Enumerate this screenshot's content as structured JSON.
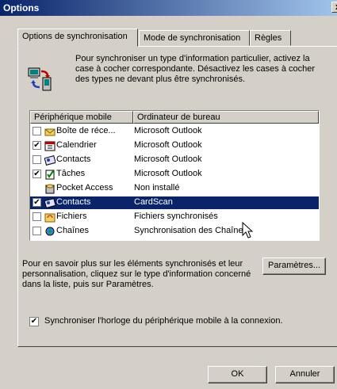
{
  "window": {
    "title": "Options",
    "close_glyph": "x"
  },
  "tabs": [
    {
      "label": "Options de synchronisation",
      "active": true
    },
    {
      "label": "Mode de synchronisation",
      "active": false
    },
    {
      "label": "Règles",
      "active": false
    }
  ],
  "intro": {
    "icon": "sync-icon",
    "text": "Pour synchroniser un type d'information particulier, activez la case à cocher correspondante. Désactivez les cases à cocher des types ne devant plus être synchronisés."
  },
  "list": {
    "headers": {
      "device": "Périphérique mobile",
      "desktop": "Ordinateur de bureau"
    },
    "rows": [
      {
        "device": "Boîte de réce...",
        "desktop": "Microsoft Outlook",
        "checked": false,
        "has_checkbox": true,
        "icon": "inbox-icon",
        "selected": false
      },
      {
        "device": "Calendrier",
        "desktop": "Microsoft Outlook",
        "checked": true,
        "has_checkbox": true,
        "icon": "calendar-icon",
        "selected": false
      },
      {
        "device": "Contacts",
        "desktop": "Microsoft Outlook",
        "checked": false,
        "has_checkbox": true,
        "icon": "contacts-icon",
        "selected": false
      },
      {
        "device": "Tâches",
        "desktop": "Microsoft Outlook",
        "checked": true,
        "has_checkbox": true,
        "icon": "tasks-icon",
        "selected": false
      },
      {
        "device": "Pocket Access",
        "desktop": "Non installé",
        "checked": false,
        "has_checkbox": false,
        "icon": "pocket-access-icon",
        "selected": false
      },
      {
        "device": "Contacts",
        "desktop": "CardScan",
        "checked": true,
        "has_checkbox": true,
        "icon": "contacts-icon",
        "selected": true
      },
      {
        "device": "Fichiers",
        "desktop": "Fichiers synchronisés",
        "checked": false,
        "has_checkbox": true,
        "icon": "files-icon",
        "selected": false
      },
      {
        "device": "Chaînes",
        "desktop": "Synchronisation des Chaînes",
        "checked": false,
        "has_checkbox": true,
        "icon": "channels-icon",
        "selected": false
      }
    ]
  },
  "info_text": "Pour en savoir plus sur les éléments synchronisés et leur personnalisation, cliquez sur le type d'information concerné dans la liste, puis sur Paramètres.",
  "buttons": {
    "settings": "Paramètres...",
    "ok": "OK",
    "cancel": "Annuler"
  },
  "clock": {
    "checked": true,
    "label": "Synchroniser l'horloge du périphérique mobile à la connexion."
  },
  "colors": {
    "selection": "#0a246a",
    "dialog": "#d4d0c8",
    "title_start": "#0a246a"
  }
}
